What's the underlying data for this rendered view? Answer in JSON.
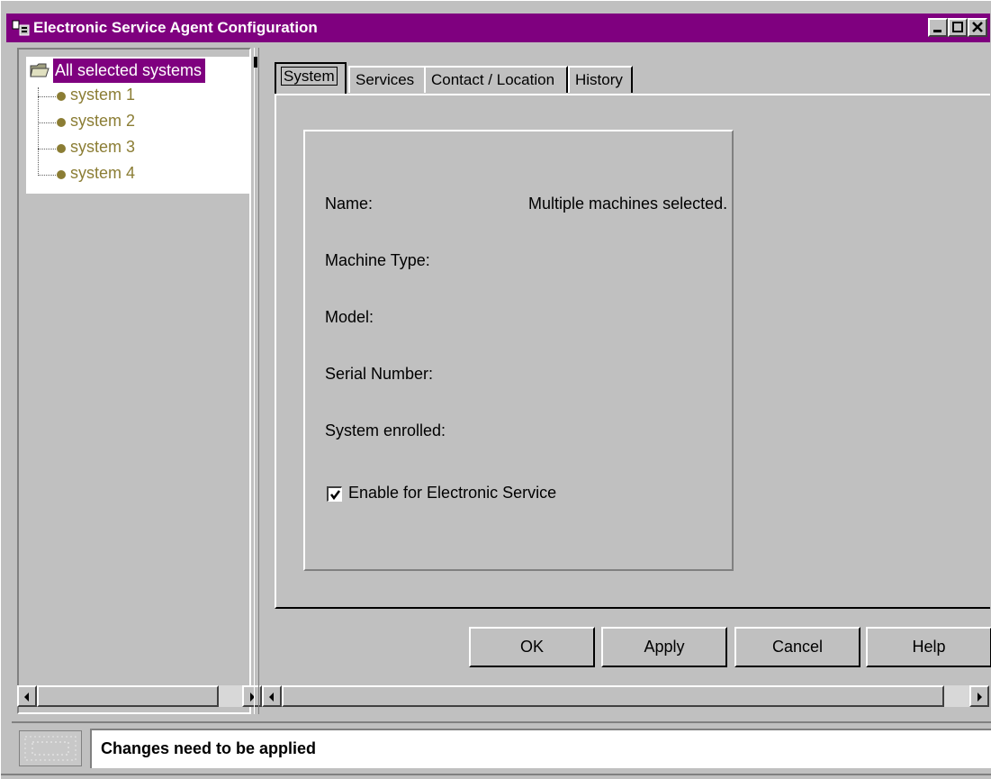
{
  "window": {
    "title": "Electronic Service Agent Configuration",
    "title_bar_color": "#7f007f"
  },
  "tree": {
    "root_label": "All selected systems",
    "root_icon": "folder-icon",
    "items": [
      {
        "label": "system 1",
        "icon": "system-node-icon"
      },
      {
        "label": "system 2",
        "icon": "system-node-icon"
      },
      {
        "label": "system 3",
        "icon": "system-node-icon"
      },
      {
        "label": "system 4",
        "icon": "system-node-icon"
      }
    ],
    "item_color": "#8b7d34"
  },
  "tabs": [
    {
      "label": "System",
      "active": true
    },
    {
      "label": "Services",
      "active": false
    },
    {
      "label": "Contact / Location",
      "active": false
    },
    {
      "label": "History",
      "active": false
    }
  ],
  "system_panel": {
    "fields": [
      {
        "label": "Name:",
        "value": "Multiple machines selected."
      },
      {
        "label": "Machine Type:",
        "value": ""
      },
      {
        "label": "Model:",
        "value": ""
      },
      {
        "label": "Serial Number:",
        "value": ""
      },
      {
        "label": "System enrolled:",
        "value": ""
      }
    ],
    "enable_checkbox": {
      "label": "Enable for Electronic Service",
      "checked": true
    }
  },
  "buttons": {
    "ok": "OK",
    "apply": "Apply",
    "cancel": "Cancel",
    "help": "Help"
  },
  "status": {
    "message": "Changes need to be applied"
  }
}
